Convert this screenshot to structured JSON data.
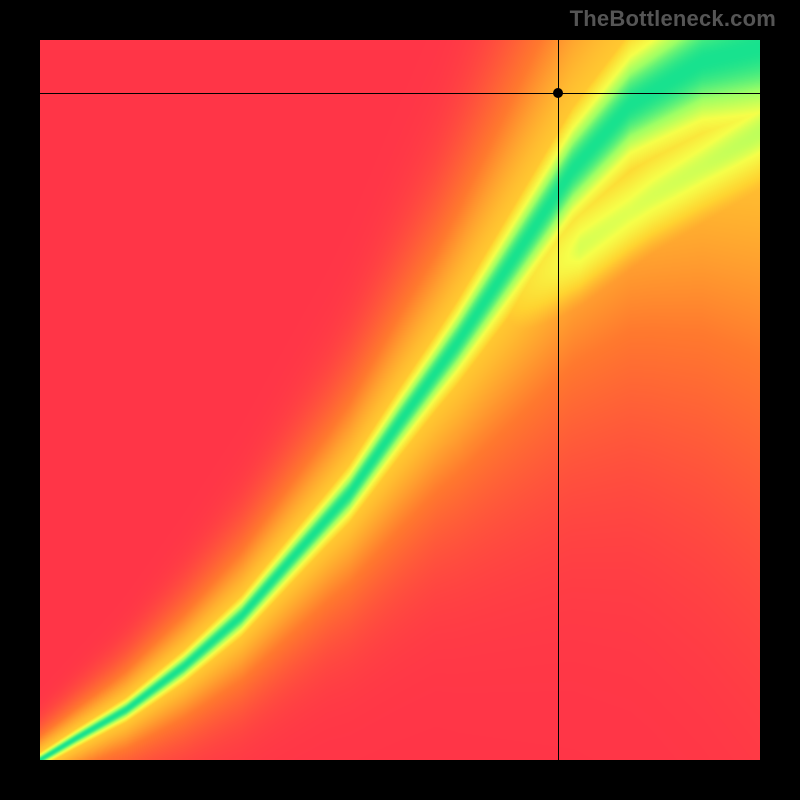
{
  "watermark": "TheBottleneck.com",
  "crosshair": {
    "x_frac": 0.72,
    "y_frac": 0.073
  },
  "chart_data": {
    "type": "heatmap",
    "title": "",
    "xlabel": "",
    "ylabel": "",
    "xlim": [
      0,
      1
    ],
    "ylim": [
      0,
      1
    ],
    "legend": false,
    "grid": false,
    "colorscale": [
      {
        "t": 0.0,
        "color": "#ff2a4c"
      },
      {
        "t": 0.35,
        "color": "#ff7a2e"
      },
      {
        "t": 0.6,
        "color": "#ffd531"
      },
      {
        "t": 0.78,
        "color": "#f6ff4a"
      },
      {
        "t": 0.9,
        "color": "#9dff66"
      },
      {
        "t": 1.0,
        "color": "#18e28f"
      }
    ],
    "ridge": {
      "description": "Ideal match curve (green ridge). Heatmap color encodes proximity to this curve.",
      "control_points_xy": [
        [
          0.0,
          0.0
        ],
        [
          0.05,
          0.03
        ],
        [
          0.12,
          0.07
        ],
        [
          0.2,
          0.13
        ],
        [
          0.28,
          0.2
        ],
        [
          0.35,
          0.28
        ],
        [
          0.43,
          0.37
        ],
        [
          0.5,
          0.47
        ],
        [
          0.58,
          0.58
        ],
        [
          0.66,
          0.7
        ],
        [
          0.74,
          0.82
        ],
        [
          0.82,
          0.91
        ],
        [
          0.92,
          0.97
        ],
        [
          1.0,
          0.99
        ]
      ],
      "half_width_y_at_x": [
        [
          0.0,
          0.01
        ],
        [
          0.1,
          0.015
        ],
        [
          0.25,
          0.025
        ],
        [
          0.4,
          0.035
        ],
        [
          0.55,
          0.05
        ],
        [
          0.7,
          0.075
        ],
        [
          0.85,
          0.1
        ],
        [
          1.0,
          0.13
        ]
      ]
    },
    "secondary_ridge": {
      "description": "Faint upper-right yellow band seen diverging from the main ridge near the top.",
      "control_points_xy": [
        [
          0.63,
          0.62
        ],
        [
          0.74,
          0.7
        ],
        [
          0.85,
          0.78
        ],
        [
          1.0,
          0.87
        ]
      ],
      "half_width_y": 0.04,
      "intensity": 0.55
    },
    "marker": {
      "x": 0.72,
      "y": 0.927,
      "label": ""
    }
  }
}
